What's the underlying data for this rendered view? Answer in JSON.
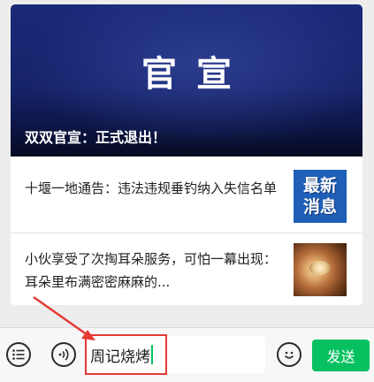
{
  "article_card": {
    "banner_title": "官宣",
    "banner_caption": "双双官宣：正式退出！",
    "items": [
      {
        "title": "十堰一地通告：违法违规垂钓纳入失信名单",
        "thumbnail_text": [
          "最新",
          "消息"
        ]
      },
      {
        "title": "小伙享受了次掏耳朵服务，可怕一幕出现：耳朵里布满密密麻麻的..."
      }
    ]
  },
  "input_bar": {
    "message_value": "周记烧烤",
    "send_label": "发送"
  },
  "colors": {
    "accent_green": "#07c160",
    "annotation_red": "#e53935",
    "banner_navy": "#16236a",
    "thumb_blue": "#1f5fb8"
  },
  "icons": [
    "list-icon",
    "voice-icon",
    "emoji-icon",
    "annotation-arrow-icon"
  ]
}
